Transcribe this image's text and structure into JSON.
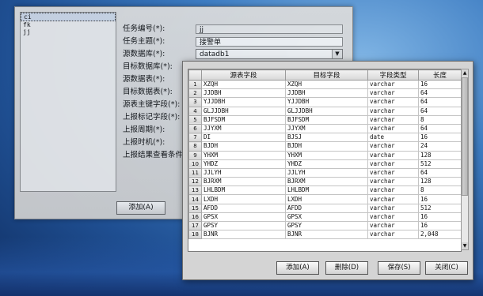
{
  "back_window": {
    "list_items": [
      "ci",
      "fk",
      "jj"
    ],
    "labels": [
      "任务编号(*):",
      "任务主题(*):",
      "源数据库(*):",
      "目标数据库(*):",
      "源数据表(*):",
      "目标数据表(*):",
      "源表主键字段(*):",
      "上报标记字段(*):",
      "上报周期(*):",
      "上报时机(*):",
      "上报结果查看条件"
    ],
    "task_id_value": "jj",
    "task_topic_value": "接警单",
    "source_db_value": "datadb1",
    "add_button": "添加(A)"
  },
  "dialog": {
    "columns": [
      "源表字段",
      "目标字段",
      "字段类型",
      "长度"
    ],
    "rows": [
      {
        "n": "1",
        "src": "XZQH",
        "dst": "XZQH",
        "type": "varchar",
        "len": "16"
      },
      {
        "n": "2",
        "src": "JJDBH",
        "dst": "JJDBH",
        "type": "varchar",
        "len": "64"
      },
      {
        "n": "3",
        "src": "YJJDBH",
        "dst": "YJJDBH",
        "type": "varchar",
        "len": "64"
      },
      {
        "n": "4",
        "src": "GLJJDBH",
        "dst": "GLJJDBH",
        "type": "varchar",
        "len": "64"
      },
      {
        "n": "5",
        "src": "BJFSDM",
        "dst": "BJFSDM",
        "type": "varchar",
        "len": "8"
      },
      {
        "n": "6",
        "src": "JJYXM",
        "dst": "JJYXM",
        "type": "varchar",
        "len": "64"
      },
      {
        "n": "7",
        "src": "DI",
        "dst": "BJSJ",
        "type": "date",
        "len": "16"
      },
      {
        "n": "8",
        "src": "BJDH",
        "dst": "BJDH",
        "type": "varchar",
        "len": "24"
      },
      {
        "n": "9",
        "src": "YHXM",
        "dst": "YHXM",
        "type": "varchar",
        "len": "128"
      },
      {
        "n": "10",
        "src": "YHDZ",
        "dst": "YHDZ",
        "type": "varchar",
        "len": "512"
      },
      {
        "n": "11",
        "src": "JJLYH",
        "dst": "JJLYH",
        "type": "varchar",
        "len": "64"
      },
      {
        "n": "12",
        "src": "BJRXM",
        "dst": "BJRXM",
        "type": "varchar",
        "len": "128"
      },
      {
        "n": "13",
        "src": "LHLBDM",
        "dst": "LHLBDM",
        "type": "varchar",
        "len": "8"
      },
      {
        "n": "14",
        "src": "LXDH",
        "dst": "LXDH",
        "type": "varchar",
        "len": "16"
      },
      {
        "n": "15",
        "src": "AFDD",
        "dst": "AFDD",
        "type": "varchar",
        "len": "512"
      },
      {
        "n": "16",
        "src": "GPSX",
        "dst": "GPSX",
        "type": "varchar",
        "len": "16"
      },
      {
        "n": "17",
        "src": "GPSY",
        "dst": "GPSY",
        "type": "varchar",
        "len": "16"
      },
      {
        "n": "18",
        "src": "BJNR",
        "dst": "BJNR",
        "type": "varchar",
        "len": "2,048"
      }
    ],
    "buttons": {
      "add": "添加(A)",
      "delete": "删除(D)",
      "save": "保存(S)",
      "close": "关闭(C)"
    }
  }
}
